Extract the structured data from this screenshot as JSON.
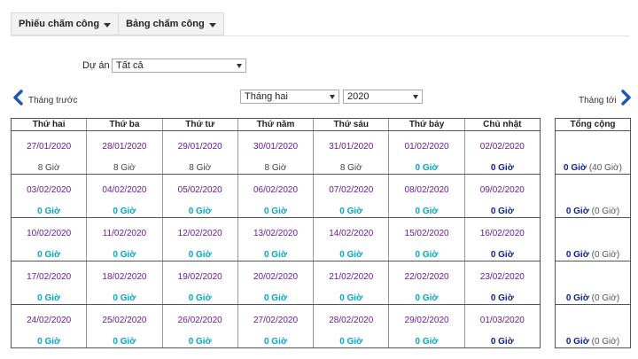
{
  "tabs": [
    {
      "label": "Phiếu chấm công"
    },
    {
      "label": "Bảng chấm công"
    }
  ],
  "filter": {
    "project_label": "Dự án",
    "project_value": "Tất cả"
  },
  "nav": {
    "prev_label": "Tháng trước",
    "next_label": "Tháng tới",
    "month_value": "Tháng hai",
    "year_value": "2020"
  },
  "weekdays": [
    "Thứ hai",
    "Thứ ba",
    "Thứ tư",
    "Thứ năm",
    "Thứ sáu",
    "Thứ bảy",
    "Chủ nhật"
  ],
  "total_header": "Tổng cộng",
  "weeks": [
    {
      "days": [
        {
          "date": "27/01/2020",
          "hours": "8 Giờ"
        },
        {
          "date": "28/01/2020",
          "hours": "8 Giờ"
        },
        {
          "date": "29/01/2020",
          "hours": "8 Giờ"
        },
        {
          "date": "30/01/2020",
          "hours": "8 Giờ"
        },
        {
          "date": "31/01/2020",
          "hours": "8 Giờ"
        },
        {
          "date": "01/02/2020",
          "hours": "0 Giờ"
        },
        {
          "date": "02/02/2020",
          "hours": "0 Giờ"
        }
      ],
      "total_worked": "0 Giờ",
      "total_planned": "(40 Giờ)"
    },
    {
      "days": [
        {
          "date": "03/02/2020",
          "hours": "0 Giờ"
        },
        {
          "date": "04/02/2020",
          "hours": "0 Giờ"
        },
        {
          "date": "05/02/2020",
          "hours": "0 Giờ"
        },
        {
          "date": "06/02/2020",
          "hours": "0 Giờ"
        },
        {
          "date": "07/02/2020",
          "hours": "0 Giờ"
        },
        {
          "date": "08/02/2020",
          "hours": "0 Giờ"
        },
        {
          "date": "09/02/2020",
          "hours": "0 Giờ"
        }
      ],
      "total_worked": "0 Giờ",
      "total_planned": "(0 Giờ)"
    },
    {
      "days": [
        {
          "date": "10/02/2020",
          "hours": "0 Giờ"
        },
        {
          "date": "11/02/2020",
          "hours": "0 Giờ"
        },
        {
          "date": "12/02/2020",
          "hours": "0 Giờ"
        },
        {
          "date": "13/02/2020",
          "hours": "0 Giờ"
        },
        {
          "date": "14/02/2020",
          "hours": "0 Giờ"
        },
        {
          "date": "15/02/2020",
          "hours": "0 Giờ"
        },
        {
          "date": "16/02/2020",
          "hours": "0 Giờ"
        }
      ],
      "total_worked": "0 Giờ",
      "total_planned": "(0 Giờ)"
    },
    {
      "days": [
        {
          "date": "17/02/2020",
          "hours": "0 Giờ"
        },
        {
          "date": "18/02/2020",
          "hours": "0 Giờ"
        },
        {
          "date": "19/02/2020",
          "hours": "0 Giờ"
        },
        {
          "date": "20/02/2020",
          "hours": "0 Giờ"
        },
        {
          "date": "21/02/2020",
          "hours": "0 Giờ"
        },
        {
          "date": "22/02/2020",
          "hours": "0 Giờ"
        },
        {
          "date": "23/02/2020",
          "hours": "0 Giờ"
        }
      ],
      "total_worked": "0 Giờ",
      "total_planned": "(0 Giờ)"
    },
    {
      "days": [
        {
          "date": "24/02/2020",
          "hours": "0 Giờ"
        },
        {
          "date": "25/02/2020",
          "hours": "0 Giờ"
        },
        {
          "date": "26/02/2020",
          "hours": "0 Giờ"
        },
        {
          "date": "27/02/2020",
          "hours": "0 Giờ"
        },
        {
          "date": "28/02/2020",
          "hours": "0 Giờ"
        },
        {
          "date": "29/02/2020",
          "hours": "0 Giờ"
        },
        {
          "date": "01/03/2020",
          "hours": "0 Giờ"
        }
      ],
      "total_worked": "0 Giờ",
      "total_planned": "(0 Giờ)"
    }
  ],
  "colors": {
    "date": "#6a1b9a",
    "hours_logged": "#444444",
    "hours_zero_weekday": "#00a8c6",
    "hours_zero_sunday": "#0a1f8f",
    "nav_chevron": "#1f56b5"
  }
}
